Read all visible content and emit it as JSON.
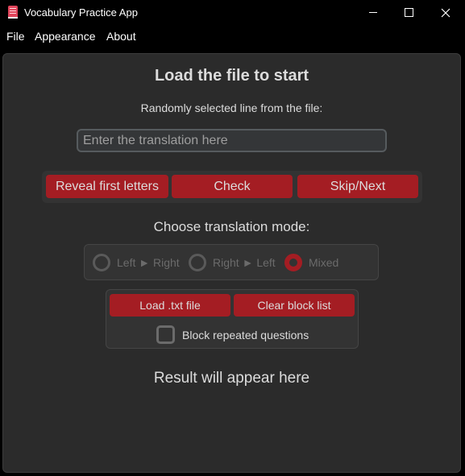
{
  "window": {
    "title": "Vocabulary Practice App",
    "icon": "book-icon"
  },
  "menu": {
    "items": [
      "File",
      "Appearance",
      "About"
    ]
  },
  "main": {
    "heading": "Load the file to start",
    "subtext": "Randomly selected line from the file:",
    "input": {
      "value": "",
      "placeholder": "Enter the translation here"
    },
    "buttons": {
      "reveal": "Reveal first letters",
      "check": "Check",
      "skip": "Skip/Next"
    },
    "mode_label": "Choose translation mode:",
    "modes": [
      {
        "label": "Left ► Right",
        "selected": false
      },
      {
        "label": "Right ► Left",
        "selected": false
      },
      {
        "label": "Mixed",
        "selected": true
      }
    ],
    "file_buttons": {
      "load": "Load .txt file",
      "clear": "Clear block list"
    },
    "block_checkbox": {
      "label": "Block repeated questions",
      "checked": false
    },
    "result": "Result will appear here"
  },
  "colors": {
    "accent": "#a41d23",
    "panel_bg": "#2b2b2b",
    "frame_bg": "#333333",
    "text": "#dcdcdc",
    "disabled_text": "#6b6b6b"
  }
}
